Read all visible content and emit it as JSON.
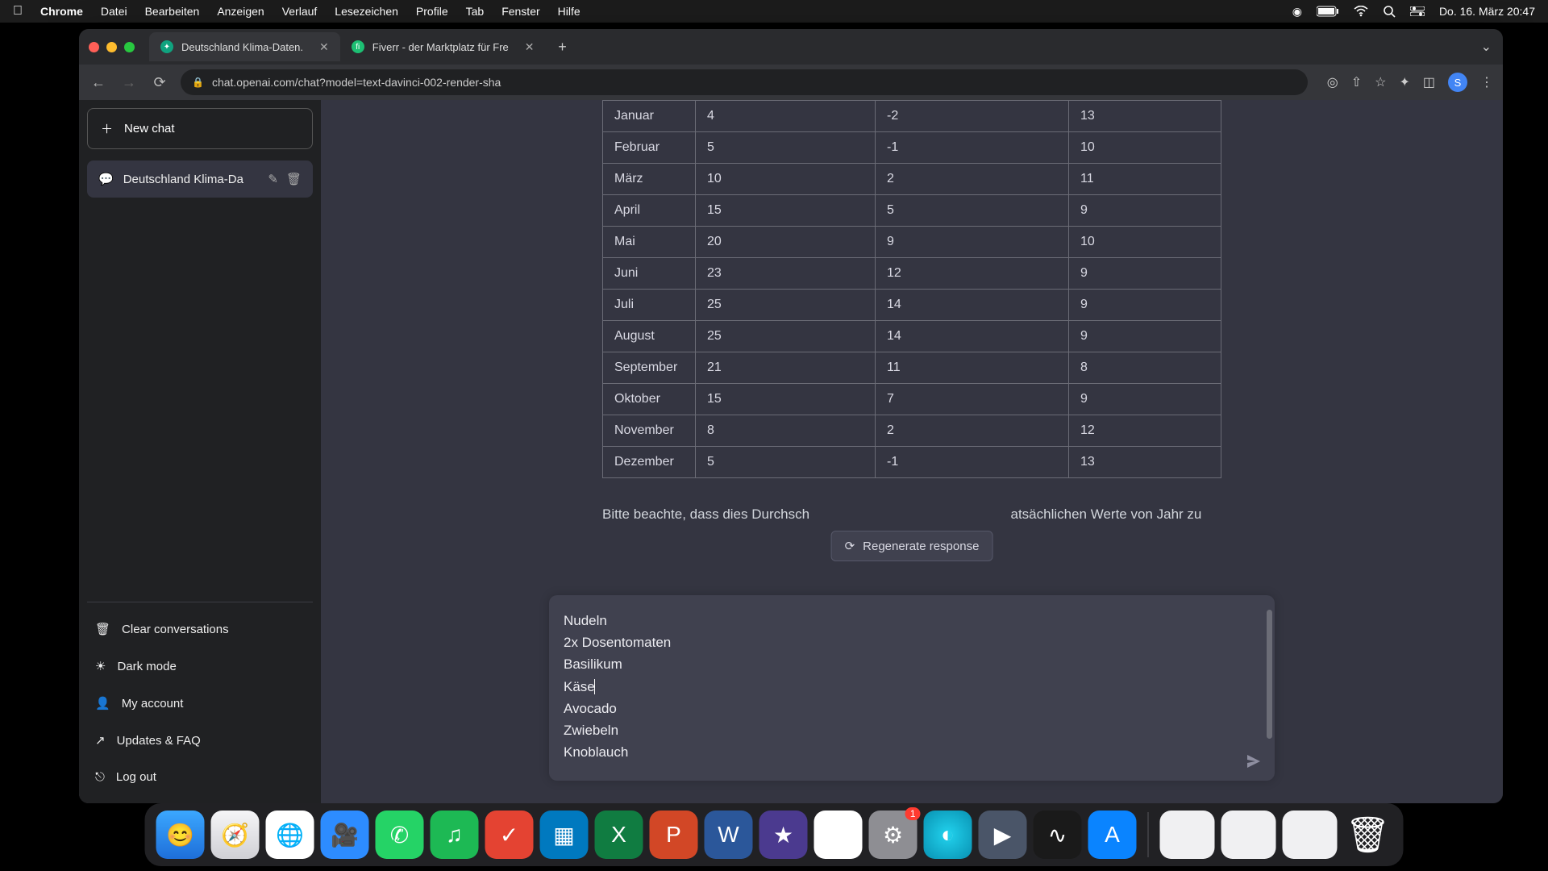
{
  "menubar": {
    "app": "Chrome",
    "items": [
      "Datei",
      "Bearbeiten",
      "Anzeigen",
      "Verlauf",
      "Lesezeichen",
      "Profile",
      "Tab",
      "Fenster",
      "Hilfe"
    ],
    "datetime": "Do. 16. März  20:47"
  },
  "tabs": {
    "active": "Deutschland Klima-Daten.",
    "second": "Fiverr - der Marktplatz für Fre"
  },
  "url": "chat.openai.com/chat?model=text-davinci-002-render-sha",
  "avatar_initial": "S",
  "sidebar": {
    "newchat": "New chat",
    "current": "Deutschland Klima-Da",
    "clear": "Clear conversations",
    "dark": "Dark mode",
    "account": "My account",
    "updates": "Updates & FAQ",
    "logout": "Log out"
  },
  "table": {
    "rows": [
      {
        "month": "Januar",
        "c1": "4",
        "c2": "-2",
        "c3": "13"
      },
      {
        "month": "Februar",
        "c1": "5",
        "c2": "-1",
        "c3": "10"
      },
      {
        "month": "März",
        "c1": "10",
        "c2": "2",
        "c3": "11"
      },
      {
        "month": "April",
        "c1": "15",
        "c2": "5",
        "c3": "9"
      },
      {
        "month": "Mai",
        "c1": "20",
        "c2": "9",
        "c3": "10"
      },
      {
        "month": "Juni",
        "c1": "23",
        "c2": "12",
        "c3": "9"
      },
      {
        "month": "Juli",
        "c1": "25",
        "c2": "14",
        "c3": "9"
      },
      {
        "month": "August",
        "c1": "25",
        "c2": "14",
        "c3": "9"
      },
      {
        "month": "September",
        "c1": "21",
        "c2": "11",
        "c3": "8"
      },
      {
        "month": "Oktober",
        "c1": "15",
        "c2": "7",
        "c3": "9"
      },
      {
        "month": "November",
        "c1": "8",
        "c2": "2",
        "c3": "12"
      },
      {
        "month": "Dezember",
        "c1": "5",
        "c2": "-1",
        "c3": "13"
      }
    ]
  },
  "note_visible_left": "Bitte beachte, dass dies Durchsch",
  "note_visible_right": "atsächlichen Werte von Jahr zu",
  "regenerate": "Regenerate response",
  "input_lines": [
    "Nudeln",
    "2x Dosentomaten",
    "Basilikum",
    "Käse",
    "Avocado",
    "Zwiebeln",
    "Knoblauch"
  ],
  "dock_badge_settings": "1"
}
